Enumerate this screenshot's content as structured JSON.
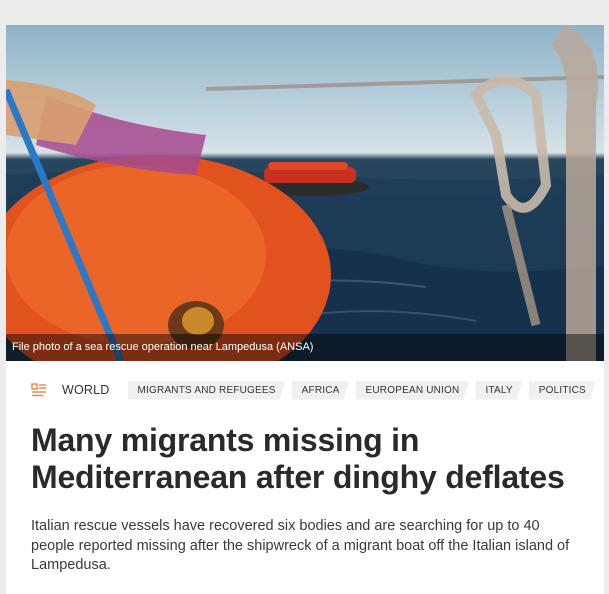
{
  "photo": {
    "caption": "File photo of a sea rescue operation near Lampedusa  (ANSA)"
  },
  "article": {
    "category": "WORLD",
    "tags": [
      "MIGRANTS AND REFUGEES",
      "AFRICA",
      "EUROPEAN UNION",
      "ITALY",
      "POLITICS"
    ],
    "title": "Many migrants missing in Mediterranean after dinghy deflates",
    "summary": "Italian rescue vessels have recovered six bodies and are searching for up to 40 people reported missing after the shipwreck of a migrant boat off the Italian island of Lampedusa."
  },
  "colors": {
    "accent": "#f0803c",
    "text": "#2a2a2a"
  },
  "icons": {
    "category": "list-icon"
  }
}
